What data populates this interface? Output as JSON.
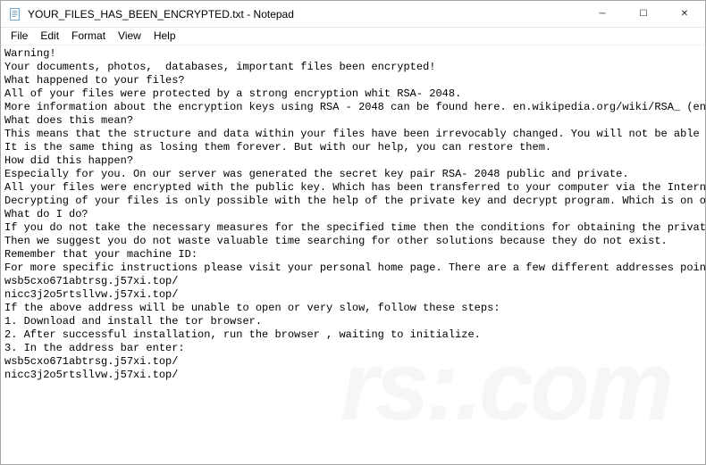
{
  "titlebar": {
    "icon_name": "notepad-document-icon",
    "title": "YOUR_FILES_HAS_BEEN_ENCRYPTED.txt - Notepad"
  },
  "window_controls": {
    "minimize_glyph": "─",
    "maximize_glyph": "☐",
    "close_glyph": "✕"
  },
  "menu": {
    "file": "File",
    "edit": "Edit",
    "format": "Format",
    "view": "View",
    "help": "Help"
  },
  "document_text": "Warning!\nYour documents, photos,  databases, important files been encrypted!\nWhat happened to your files?\nAll of your files were protected by a strong encryption whit RSA- 2048.\nMore information about the encryption keys using RSA - 2048 can be found here. en.wikipedia.org/wiki/RSA_ (encrypt\nWhat does this mean?\nThis means that the structure and data within your files have been irrevocably changed. You will not be able to wo\nIt is the same thing as losing them forever. But with our help, you can restore them.\nHow did this happen?\nEspecially for you. On our server was generated the secret key pair RSA- 2048 public and private.\nAll your files were encrypted with the public key. Which has been transferred to your computer via the Internet.\nDecrypting of your files is only possible with the help of the private key and decrypt program. Which is on our se\nWhat do I do?\nIf you do not take the necessary measures for the specified time then the conditions for obtaining the private key\nThen we suggest you do not waste valuable time searching for other solutions because they do not exist.\nRemember that your machine ID:\nFor more specific instructions please visit your personal home page. There are a few different addresses pointing \nwsb5cxo671abtrsg.j57xi.top/\nnicc3j2o5rtsllvw.j57xi.top/\nIf the above address will be unable to open or very slow, follow these steps:\n1. Download and install the tor browser.\n2. After successful installation, run the browser , waiting to initialize.\n3. In the address bar enter:\nwsb5cxo671abtrsg.j57xi.top/\nnicc3j2o5rtsllvw.j57xi.top/",
  "watermark_text": "rs:.com"
}
